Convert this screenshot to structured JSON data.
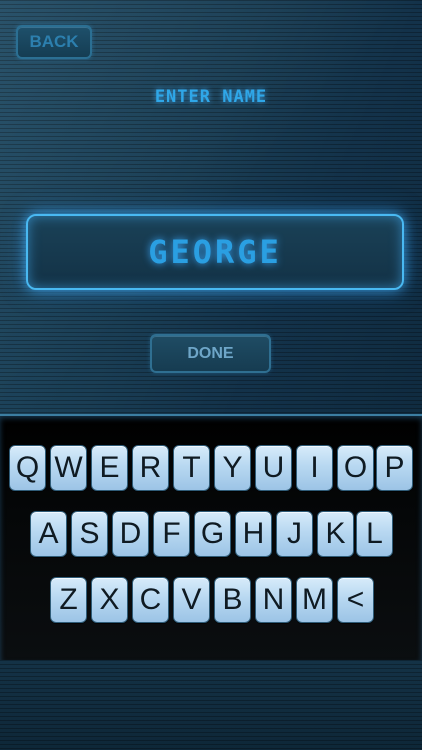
{
  "header": {
    "back_label": "BACK",
    "prompt": "ENTER NAME"
  },
  "name_field": {
    "value": "GEORGE"
  },
  "actions": {
    "done_label": "DONE"
  },
  "keyboard": {
    "row1": [
      "Q",
      "W",
      "E",
      "R",
      "T",
      "Y",
      "U",
      "I",
      "O",
      "P"
    ],
    "row2": [
      "A",
      "S",
      "D",
      "F",
      "G",
      "H",
      "J",
      "K",
      "L"
    ],
    "row3": [
      "Z",
      "X",
      "C",
      "V",
      "B",
      "N",
      "M",
      "<"
    ]
  },
  "colors": {
    "accent": "#49b9f2",
    "text_glow": "#2fa7e8",
    "key_face": "#b8d8f1"
  }
}
